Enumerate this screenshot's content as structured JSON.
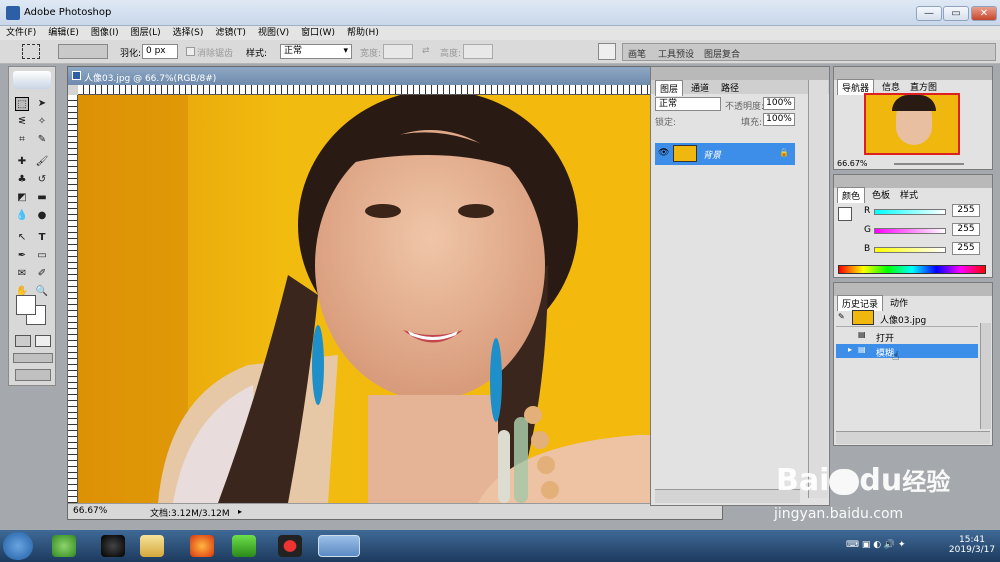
{
  "app": {
    "title": "Adobe Photoshop"
  },
  "window_controls": {
    "minimize": "—",
    "restore": "▭",
    "close": "✕"
  },
  "menu": [
    "文件(F)",
    "编辑(E)",
    "图像(I)",
    "图层(L)",
    "选择(S)",
    "滤镜(T)",
    "视图(V)",
    "窗口(W)",
    "帮助(H)"
  ],
  "options_bar": {
    "feather_label": "羽化:",
    "feather_value": "0 px",
    "antialias_label": "消除锯齿",
    "style_label": "样式:",
    "style_value": "正常",
    "width_label": "宽度:",
    "height_label": "高度:",
    "palette_well_tabs": [
      "画笔",
      "工具预设",
      "图层复合"
    ]
  },
  "document": {
    "title": "人像03.jpg @ 66.7%(RGB/8#)",
    "zoom": "66.67%",
    "doc_size": "文档:3.12M/3.12M"
  },
  "layers_panel": {
    "tabs": [
      "图层",
      "通道",
      "路径"
    ],
    "blend_mode": "正常",
    "opacity_label": "不透明度:",
    "opacity_value": "100%",
    "lock_label": "锁定:",
    "fill_label": "填充:",
    "fill_value": "100%",
    "layers": [
      {
        "name": "背景",
        "visible": true,
        "locked": true
      }
    ]
  },
  "navigator_panel": {
    "tabs": [
      "导航器",
      "信息",
      "直方图"
    ],
    "zoom": "66.67%"
  },
  "color_panel": {
    "tabs": [
      "颜色",
      "色板",
      "样式"
    ],
    "channels": [
      {
        "label": "R",
        "value": "255"
      },
      {
        "label": "G",
        "value": "255"
      },
      {
        "label": "B",
        "value": "255"
      }
    ]
  },
  "history_panel": {
    "tabs": [
      "历史记录",
      "动作"
    ],
    "snapshot": "人像03.jpg",
    "items": [
      {
        "label": "打开",
        "selected": false
      },
      {
        "label": "模糊",
        "selected": true
      }
    ]
  },
  "taskbar": {
    "time": "15:41",
    "date": "2019/3/17"
  },
  "watermark": {
    "brand": "Bai",
    "brand2": "du",
    "suffix": "经验",
    "url": "jingyan.baidu.com"
  },
  "colors": {
    "accent": "#3d8ee8",
    "title_blue": "#6f8bad",
    "photo_bg": "#f0b70f"
  }
}
